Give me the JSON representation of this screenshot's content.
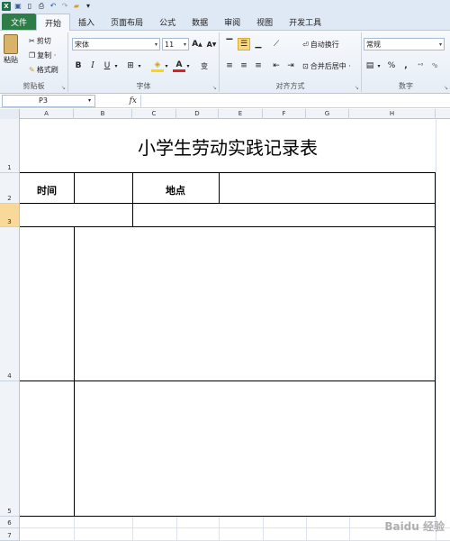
{
  "ribbon_tabs": [
    "文件",
    "开始",
    "插入",
    "页面布局",
    "公式",
    "数据",
    "审阅",
    "视图",
    "开发工具"
  ],
  "clipboard": {
    "paste": "粘贴",
    "cut": "剪切",
    "copy": "复制 ·",
    "format_painter": "格式刷",
    "group_label": "剪贴板"
  },
  "font": {
    "family": "宋体",
    "size": "11",
    "group_label": "字体",
    "bold": "B",
    "italic": "I",
    "underline": "U",
    "wen": "变"
  },
  "alignment": {
    "wrap_text": "自动换行",
    "merge_center": "合并后居中 ·",
    "group_label": "对齐方式"
  },
  "number": {
    "format": "常规",
    "percent": "%",
    "comma": ",",
    "group_label": "数字"
  },
  "formula_bar": {
    "name_box": "P3",
    "fx": "fx",
    "value": ""
  },
  "columns": [
    "A",
    "B",
    "C",
    "D",
    "E",
    "F",
    "G",
    "H"
  ],
  "rows": [
    "1",
    "2",
    "3",
    "4",
    "5",
    "6",
    "7"
  ],
  "sheet": {
    "title": "小学生劳动实践记录表",
    "time_label": "时间",
    "place_label": "地点"
  },
  "watermark": "Baidu 经验",
  "colors": {
    "file_tab": "#2d7d46",
    "selected_row": "#f9d99a",
    "ribbon": "#e6edf6"
  }
}
